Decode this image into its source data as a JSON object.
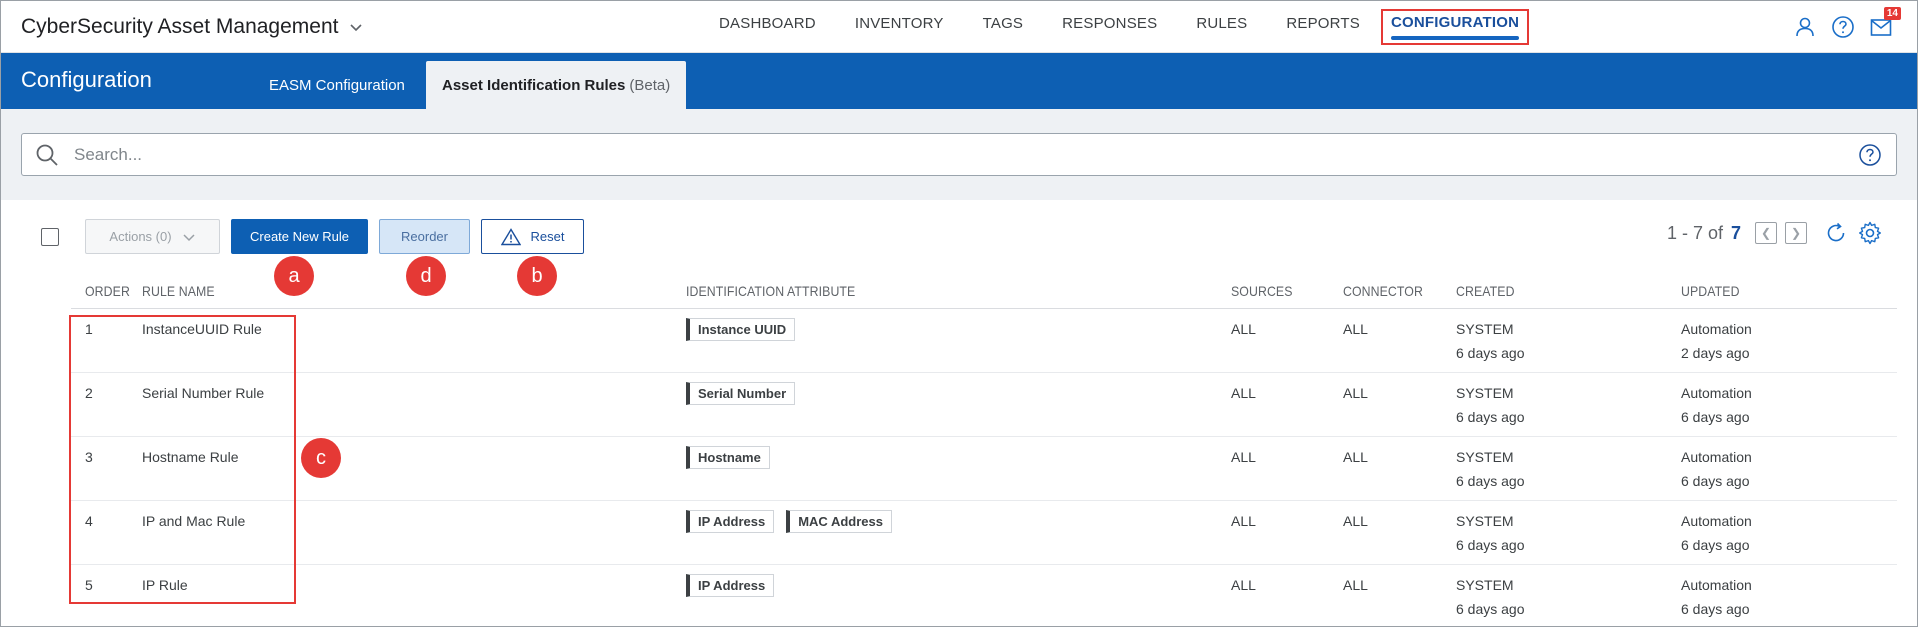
{
  "app": {
    "title": "CyberSecurity Asset Management"
  },
  "nav": {
    "items": [
      {
        "label": "DASHBOARD"
      },
      {
        "label": "INVENTORY"
      },
      {
        "label": "TAGS"
      },
      {
        "label": "RESPONSES"
      },
      {
        "label": "RULES"
      },
      {
        "label": "REPORTS"
      }
    ],
    "active": "CONFIGURATION"
  },
  "notifications": {
    "count": "14"
  },
  "config": {
    "title": "Configuration",
    "tabs": [
      {
        "label": "EASM Configuration"
      },
      {
        "label": "Asset Identification Rules",
        "suffix": "(Beta)"
      }
    ]
  },
  "search": {
    "placeholder": "Search..."
  },
  "toolbar": {
    "actions_label": "Actions (0)",
    "create_label": "Create New Rule",
    "reorder_label": "Reorder",
    "reset_label": "Reset"
  },
  "pagination": {
    "range": "1 - 7 of",
    "total": "7"
  },
  "callouts": {
    "a": "a",
    "b": "b",
    "c": "c",
    "d": "d"
  },
  "table": {
    "headers": {
      "order": "ORDER",
      "rule_name": "RULE NAME",
      "attribute": "IDENTIFICATION ATTRIBUTE",
      "sources": "SOURCES",
      "connector": "CONNECTOR",
      "created": "CREATED",
      "updated": "UPDATED"
    },
    "rows": [
      {
        "order": "1",
        "name": "InstanceUUID Rule",
        "attrs": [
          "Instance UUID"
        ],
        "sources": "ALL",
        "connector": "ALL",
        "created_by": "SYSTEM",
        "created_ago": "6 days ago",
        "updated_by": "Automation",
        "updated_ago": "2 days ago"
      },
      {
        "order": "2",
        "name": "Serial Number Rule",
        "attrs": [
          "Serial Number"
        ],
        "sources": "ALL",
        "connector": "ALL",
        "created_by": "SYSTEM",
        "created_ago": "6 days ago",
        "updated_by": "Automation",
        "updated_ago": "6 days ago"
      },
      {
        "order": "3",
        "name": "Hostname Rule",
        "attrs": [
          "Hostname"
        ],
        "sources": "ALL",
        "connector": "ALL",
        "created_by": "SYSTEM",
        "created_ago": "6 days ago",
        "updated_by": "Automation",
        "updated_ago": "6 days ago"
      },
      {
        "order": "4",
        "name": "IP and Mac Rule",
        "attrs": [
          "IP Address",
          "MAC Address"
        ],
        "sources": "ALL",
        "connector": "ALL",
        "created_by": "SYSTEM",
        "created_ago": "6 days ago",
        "updated_by": "Automation",
        "updated_ago": "6 days ago"
      },
      {
        "order": "5",
        "name": "IP Rule",
        "attrs": [
          "IP Address"
        ],
        "sources": "ALL",
        "connector": "ALL",
        "created_by": "SYSTEM",
        "created_ago": "6 days ago",
        "updated_by": "Automation",
        "updated_ago": "6 days ago"
      }
    ]
  }
}
